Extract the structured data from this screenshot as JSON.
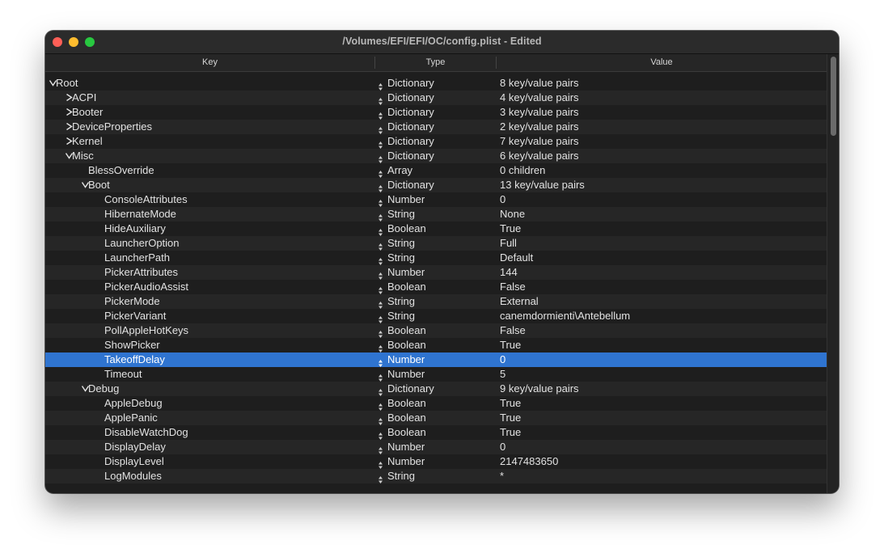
{
  "window": {
    "title": "/Volumes/EFI/EFI/OC/config.plist - Edited"
  },
  "columns": {
    "key": "Key",
    "type": "Type",
    "value": "Value"
  },
  "rows": [
    {
      "key": "Root",
      "type": "Dictionary",
      "value": "8 key/value pairs",
      "depth": 0,
      "disclosure": "open"
    },
    {
      "key": "ACPI",
      "type": "Dictionary",
      "value": "4 key/value pairs",
      "depth": 1,
      "disclosure": "closed"
    },
    {
      "key": "Booter",
      "type": "Dictionary",
      "value": "3 key/value pairs",
      "depth": 1,
      "disclosure": "closed"
    },
    {
      "key": "DeviceProperties",
      "type": "Dictionary",
      "value": "2 key/value pairs",
      "depth": 1,
      "disclosure": "closed"
    },
    {
      "key": "Kernel",
      "type": "Dictionary",
      "value": "7 key/value pairs",
      "depth": 1,
      "disclosure": "closed"
    },
    {
      "key": "Misc",
      "type": "Dictionary",
      "value": "6 key/value pairs",
      "depth": 1,
      "disclosure": "open"
    },
    {
      "key": "BlessOverride",
      "type": "Array",
      "value": "0 children",
      "depth": 2,
      "disclosure": "none"
    },
    {
      "key": "Boot",
      "type": "Dictionary",
      "value": "13 key/value pairs",
      "depth": 2,
      "disclosure": "open"
    },
    {
      "key": "ConsoleAttributes",
      "type": "Number",
      "value": "0",
      "depth": 3,
      "disclosure": "none"
    },
    {
      "key": "HibernateMode",
      "type": "String",
      "value": "None",
      "depth": 3,
      "disclosure": "none"
    },
    {
      "key": "HideAuxiliary",
      "type": "Boolean",
      "value": "True",
      "depth": 3,
      "disclosure": "none"
    },
    {
      "key": "LauncherOption",
      "type": "String",
      "value": "Full",
      "depth": 3,
      "disclosure": "none"
    },
    {
      "key": "LauncherPath",
      "type": "String",
      "value": "Default",
      "depth": 3,
      "disclosure": "none"
    },
    {
      "key": "PickerAttributes",
      "type": "Number",
      "value": "144",
      "depth": 3,
      "disclosure": "none"
    },
    {
      "key": "PickerAudioAssist",
      "type": "Boolean",
      "value": "False",
      "depth": 3,
      "disclosure": "none"
    },
    {
      "key": "PickerMode",
      "type": "String",
      "value": "External",
      "depth": 3,
      "disclosure": "none"
    },
    {
      "key": "PickerVariant",
      "type": "String",
      "value": "canemdormienti\\Antebellum",
      "depth": 3,
      "disclosure": "none"
    },
    {
      "key": "PollAppleHotKeys",
      "type": "Boolean",
      "value": "False",
      "depth": 3,
      "disclosure": "none"
    },
    {
      "key": "ShowPicker",
      "type": "Boolean",
      "value": "True",
      "depth": 3,
      "disclosure": "none"
    },
    {
      "key": "TakeoffDelay",
      "type": "Number",
      "value": "0",
      "depth": 3,
      "disclosure": "none",
      "selected": true
    },
    {
      "key": "Timeout",
      "type": "Number",
      "value": "5",
      "depth": 3,
      "disclosure": "none"
    },
    {
      "key": "Debug",
      "type": "Dictionary",
      "value": "9 key/value pairs",
      "depth": 2,
      "disclosure": "open"
    },
    {
      "key": "AppleDebug",
      "type": "Boolean",
      "value": "True",
      "depth": 3,
      "disclosure": "none"
    },
    {
      "key": "ApplePanic",
      "type": "Boolean",
      "value": "True",
      "depth": 3,
      "disclosure": "none"
    },
    {
      "key": "DisableWatchDog",
      "type": "Boolean",
      "value": "True",
      "depth": 3,
      "disclosure": "none"
    },
    {
      "key": "DisplayDelay",
      "type": "Number",
      "value": "0",
      "depth": 3,
      "disclosure": "none"
    },
    {
      "key": "DisplayLevel",
      "type": "Number",
      "value": "2147483650",
      "depth": 3,
      "disclosure": "none"
    },
    {
      "key": "LogModules",
      "type": "String",
      "value": "*",
      "depth": 3,
      "disclosure": "none"
    }
  ],
  "colors": {
    "selection": "#2f74d0",
    "close": "#ff5f57",
    "minimize": "#febc2e",
    "zoom": "#28c840"
  }
}
